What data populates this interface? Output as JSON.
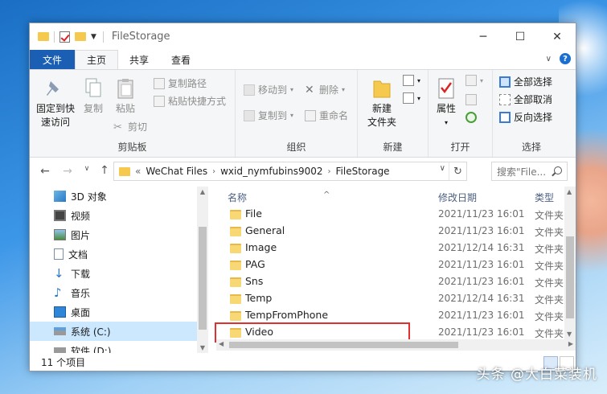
{
  "window": {
    "title": "FileStorage"
  },
  "ribbon_tabs": [
    "文件",
    "主页",
    "共享",
    "查看"
  ],
  "clipboard": {
    "pin_label_1": "固定到快",
    "pin_label_2": "速访问",
    "copy": "复制",
    "paste": "粘贴",
    "copy_path": "复制路径",
    "paste_shortcut": "粘贴快捷方式",
    "cut": "剪切",
    "group": "剪贴板"
  },
  "organize": {
    "move_to": "移动到",
    "delete": "删除",
    "copy_to": "复制到",
    "rename": "重命名",
    "group": "组织"
  },
  "new_group": {
    "new_folder_1": "新建",
    "new_folder_2": "文件夹",
    "group": "新建"
  },
  "open_group": {
    "properties": "属性",
    "group": "打开"
  },
  "select_group": {
    "select_all": "全部选择",
    "select_none": "全部取消",
    "invert": "反向选择",
    "group": "选择"
  },
  "address": {
    "prefix": "«",
    "crumbs": [
      "WeChat Files",
      "wxid_nymfubins9002",
      "FileStorage"
    ],
    "search_placeholder": "搜索\"File..."
  },
  "nav_pane": [
    {
      "label": "3D 对象",
      "icon": "3d-objects-icon"
    },
    {
      "label": "视频",
      "icon": "videos-icon"
    },
    {
      "label": "图片",
      "icon": "pictures-icon"
    },
    {
      "label": "文档",
      "icon": "documents-icon"
    },
    {
      "label": "下载",
      "icon": "downloads-icon"
    },
    {
      "label": "音乐",
      "icon": "music-icon"
    },
    {
      "label": "桌面",
      "icon": "desktop-icon"
    },
    {
      "label": "系统 (C:)",
      "icon": "drive-c-icon",
      "selected": true
    },
    {
      "label": "软件 (D:)",
      "icon": "drive-d-icon"
    }
  ],
  "columns": {
    "name": "名称",
    "modified": "修改日期",
    "type": "类型"
  },
  "files": [
    {
      "name": "File",
      "modified": "2021/11/23 16:01",
      "type": "文件夹"
    },
    {
      "name": "General",
      "modified": "2021/11/23 16:01",
      "type": "文件夹"
    },
    {
      "name": "Image",
      "modified": "2021/12/14 16:31",
      "type": "文件夹"
    },
    {
      "name": "PAG",
      "modified": "2021/11/23 16:01",
      "type": "文件夹"
    },
    {
      "name": "Sns",
      "modified": "2021/11/23 16:01",
      "type": "文件夹"
    },
    {
      "name": "Temp",
      "modified": "2021/12/14 16:31",
      "type": "文件夹"
    },
    {
      "name": "TempFromPhone",
      "modified": "2021/11/23 16:01",
      "type": "文件夹"
    },
    {
      "name": "Video",
      "modified": "2021/11/23 16:01",
      "type": "文件夹"
    }
  ],
  "status": {
    "count": "11 个项目"
  },
  "watermark": "头条 @大白菜装机",
  "colors": {
    "accent": "#1a5fb4",
    "selection": "#cce8ff",
    "highlight_box": "#e03030",
    "folder": "#f8d775"
  }
}
